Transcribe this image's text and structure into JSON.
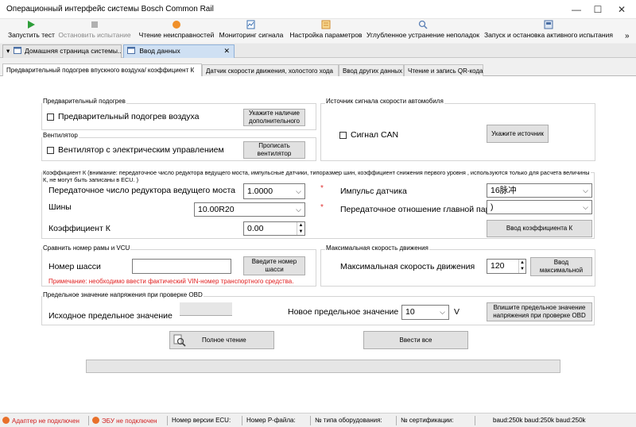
{
  "window": {
    "title": "Операционный интерфейс системы Bosch Common Rail",
    "minimize": "—",
    "maximize": "☐",
    "close": "✕"
  },
  "toolbar": {
    "items": [
      {
        "label": "Запустить тест",
        "icon": "play-icon",
        "color": "#2e9e3a"
      },
      {
        "label": "Остановить испытание",
        "icon": "stop-icon",
        "color": "#b0b0b0"
      },
      {
        "label": "Чтение неисправностей",
        "icon": "fault-read-icon",
        "color": "#f0902a"
      },
      {
        "label": "Мониторинг сигнала",
        "icon": "monitor-icon",
        "color": "#3a6fb0"
      },
      {
        "label": "Настройка параметров",
        "icon": "parameters-icon",
        "color": "#d08a30"
      },
      {
        "label": "Углубленное устранение неполадок",
        "icon": "search-icon",
        "color": "#5a7fb5"
      },
      {
        "label": "Запуск и остановка активного испытания",
        "icon": "active-test-icon",
        "color": "#4a6fa5"
      }
    ],
    "overflow": "»"
  },
  "doc_tabs": [
    {
      "label": "Домашняя страница системы...",
      "arrow": "▾"
    },
    {
      "label": "Ввод данных",
      "close": "✕"
    }
  ],
  "inner_tabs": [
    "Предварительный подогрев впускного воздуха/ коэффициент К",
    "Датчик скорости движения, холостого хода",
    "Ввод других данных",
    "Чтение и запись QR-кода"
  ],
  "preheat": {
    "group_title": "Предварительный подогрев",
    "checkbox_label": "Предварительный подогрев воздуха",
    "button": "Укажите наличие дополнительного"
  },
  "fan": {
    "group_title": "Вентилятор",
    "checkbox_label": "Вентилятор с электрическим управлением",
    "button": "Прописать вентилятор"
  },
  "speed_source": {
    "group_title": "Источник сигнала скорости автомобиля",
    "checkbox_label": "Сигнал CAN",
    "button": "Укажите источник"
  },
  "k_coef": {
    "group_title": "Коэффициент К (внимание: передаточное число редуктора ведущего моста, импульсные датчики, типоразмер шин, коэффициент снижения первого уровня , используются только для расчета величины К, не могут быть записаны в ECU. )",
    "axle_label": "Передаточное число редуктора ведущего моста",
    "axle_value": "1.0000",
    "tires_label": "Шины",
    "tires_value": "10.00R20",
    "k_label": "Коэффициент К",
    "k_value": "0.00",
    "pulse_label": "Импульс датчика",
    "pulse_value": "16脉冲",
    "main_ratio_label": "Передаточное отношение главной пары",
    "main_ratio_value": ")",
    "star": "*",
    "button": "Ввод коэффициента К"
  },
  "frame": {
    "group_title": "Сравнить номер рамы и VCU",
    "chassis_label": "Номер шасси",
    "chassis_value": "",
    "button": "Введите номер шасси",
    "note": "Примечание: необходимо ввести фактический VIN-номер транспортного средства."
  },
  "max_speed": {
    "group_title": "Максимальная скорость движения",
    "label": "Максимальная скорость движения",
    "value": "120",
    "button": "Ввод максимальной"
  },
  "obd": {
    "group_title": "Предельное значение напряжения при проверке OBD",
    "initial_label": "Исходное предельное значение",
    "new_label": "Новое предельное значение",
    "new_value": "10",
    "unit": "V",
    "button": "Впишите предельное значение напряжения при проверке OBD"
  },
  "actions": {
    "full_read": "Полное чтение",
    "enter_all": "Ввести все"
  },
  "progress": {
    "value": 0
  },
  "status": {
    "adapter": "Адаптер не подключен",
    "ecu": "ЭБУ не подключен",
    "ecu_version": "Номер версии ECU:",
    "p_file": "Номер Р-файла:",
    "hw_type": "№ типа оборудования:",
    "cert": "№ сертификации:",
    "baud": "baud:250k baud:250k baud:250k",
    "indicator_color": "#e8702a"
  }
}
